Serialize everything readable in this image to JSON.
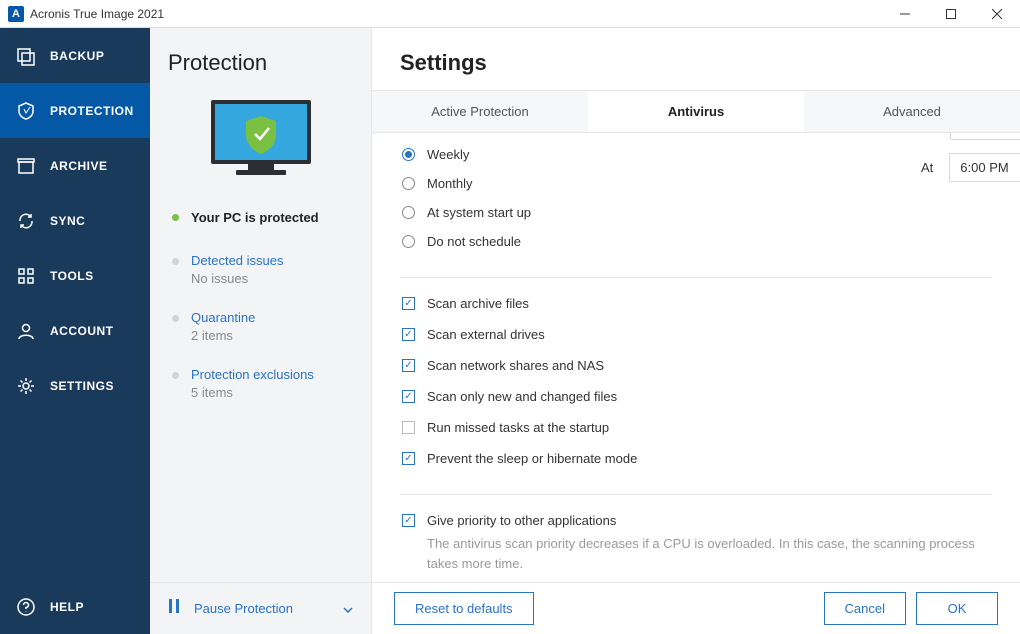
{
  "app": {
    "title": "Acronis True Image 2021"
  },
  "sidebar": {
    "items": [
      {
        "label": "BACKUP"
      },
      {
        "label": "PROTECTION"
      },
      {
        "label": "ARCHIVE"
      },
      {
        "label": "SYNC"
      },
      {
        "label": "TOOLS"
      },
      {
        "label": "ACCOUNT"
      },
      {
        "label": "SETTINGS"
      }
    ],
    "help_label": "HELP"
  },
  "secondary": {
    "heading": "Protection",
    "status_text": "Your PC is protected",
    "groups": [
      {
        "link": "Detected issues",
        "sub": "No issues"
      },
      {
        "link": "Quarantine",
        "sub": "2 items"
      },
      {
        "link": "Protection exclusions",
        "sub": "5 items"
      }
    ],
    "pause_label": "Pause Protection"
  },
  "settings": {
    "title": "Settings",
    "tabs": [
      {
        "label": "Active Protection"
      },
      {
        "label": "Antivirus"
      },
      {
        "label": "Advanced"
      }
    ],
    "schedule": {
      "options": [
        {
          "label": "Weekly",
          "checked": true
        },
        {
          "label": "Monthly",
          "checked": false
        },
        {
          "label": "At system start up",
          "checked": false
        },
        {
          "label": "Do not schedule",
          "checked": false
        }
      ],
      "at_label": "At",
      "time_value": "6:00 PM"
    },
    "scan_options": [
      {
        "label": "Scan archive files",
        "checked": true
      },
      {
        "label": "Scan external drives",
        "checked": true
      },
      {
        "label": "Scan network shares and NAS",
        "checked": true
      },
      {
        "label": "Scan only new and changed files",
        "checked": true
      },
      {
        "label": "Run missed tasks at the startup",
        "checked": false
      },
      {
        "label": "Prevent the sleep or hibernate mode",
        "checked": true
      }
    ],
    "priority": {
      "label": "Give priority to other applications",
      "checked": true,
      "desc": "The antivirus scan priority decreases if a CPU is overloaded. In this case, the scanning process takes more time."
    },
    "buttons": {
      "reset": "Reset to defaults",
      "cancel": "Cancel",
      "ok": "OK"
    }
  }
}
